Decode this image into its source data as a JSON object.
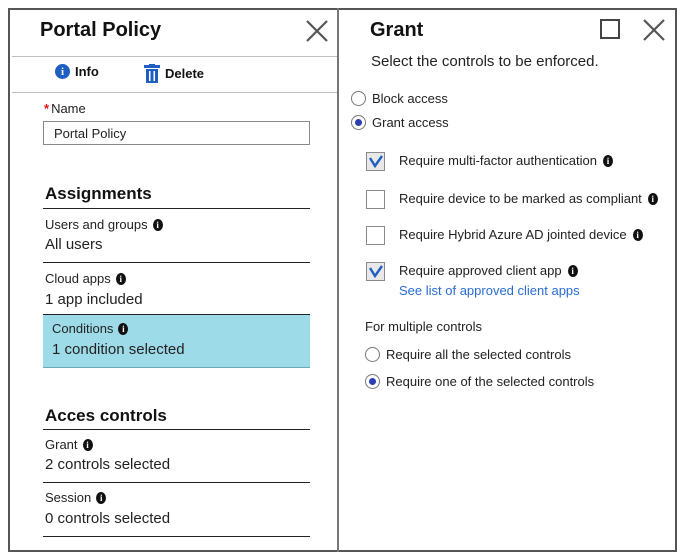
{
  "left": {
    "title": "Portal Policy",
    "toolbar": {
      "info_label": "Info",
      "delete_label": "Delete"
    },
    "name_field": {
      "label": "Name",
      "required_mark": "*",
      "value": "Portal Policy"
    },
    "assignments": {
      "title": "Assignments",
      "items": [
        {
          "label": "Users and groups",
          "value": "All users"
        },
        {
          "label": "Cloud apps",
          "value": "1 app included"
        },
        {
          "label": "Conditions",
          "value": "1 condition selected",
          "selected": true
        }
      ]
    },
    "access_controls": {
      "title": "Acces controls",
      "items": [
        {
          "label": "Grant",
          "value": "2 controls selected"
        },
        {
          "label": "Session",
          "value": "0 controls selected"
        }
      ]
    }
  },
  "right": {
    "title": "Grant",
    "subtitle": "Select the controls to be enforced.",
    "access_options": [
      {
        "label": "Block access",
        "selected": false
      },
      {
        "label": "Grant access",
        "selected": true
      }
    ],
    "controls": [
      {
        "label": "Require multi-factor authentication",
        "checked": true
      },
      {
        "label": "Require device to be marked as compliant",
        "checked": false
      },
      {
        "label": "Require Hybrid Azure AD jointed device",
        "checked": false
      },
      {
        "label": "Require approved client app",
        "checked": true,
        "link": "See list of approved client apps"
      }
    ],
    "multiple_controls": {
      "label": "For multiple controls",
      "options": [
        {
          "label": "Require all the selected controls",
          "selected": false
        },
        {
          "label": "Require one of the selected controls",
          "selected": true
        }
      ]
    }
  },
  "colors": {
    "selected_bg": "#9edbe8",
    "radio_on": "#2b3fb5",
    "check": "#1f5fc2",
    "link": "#2a6bd1"
  },
  "icons": {
    "info": "info-icon",
    "delete": "trash-icon",
    "close": "close-icon",
    "maximize": "maximize-icon",
    "tooltip": "info-tooltip-icon"
  }
}
